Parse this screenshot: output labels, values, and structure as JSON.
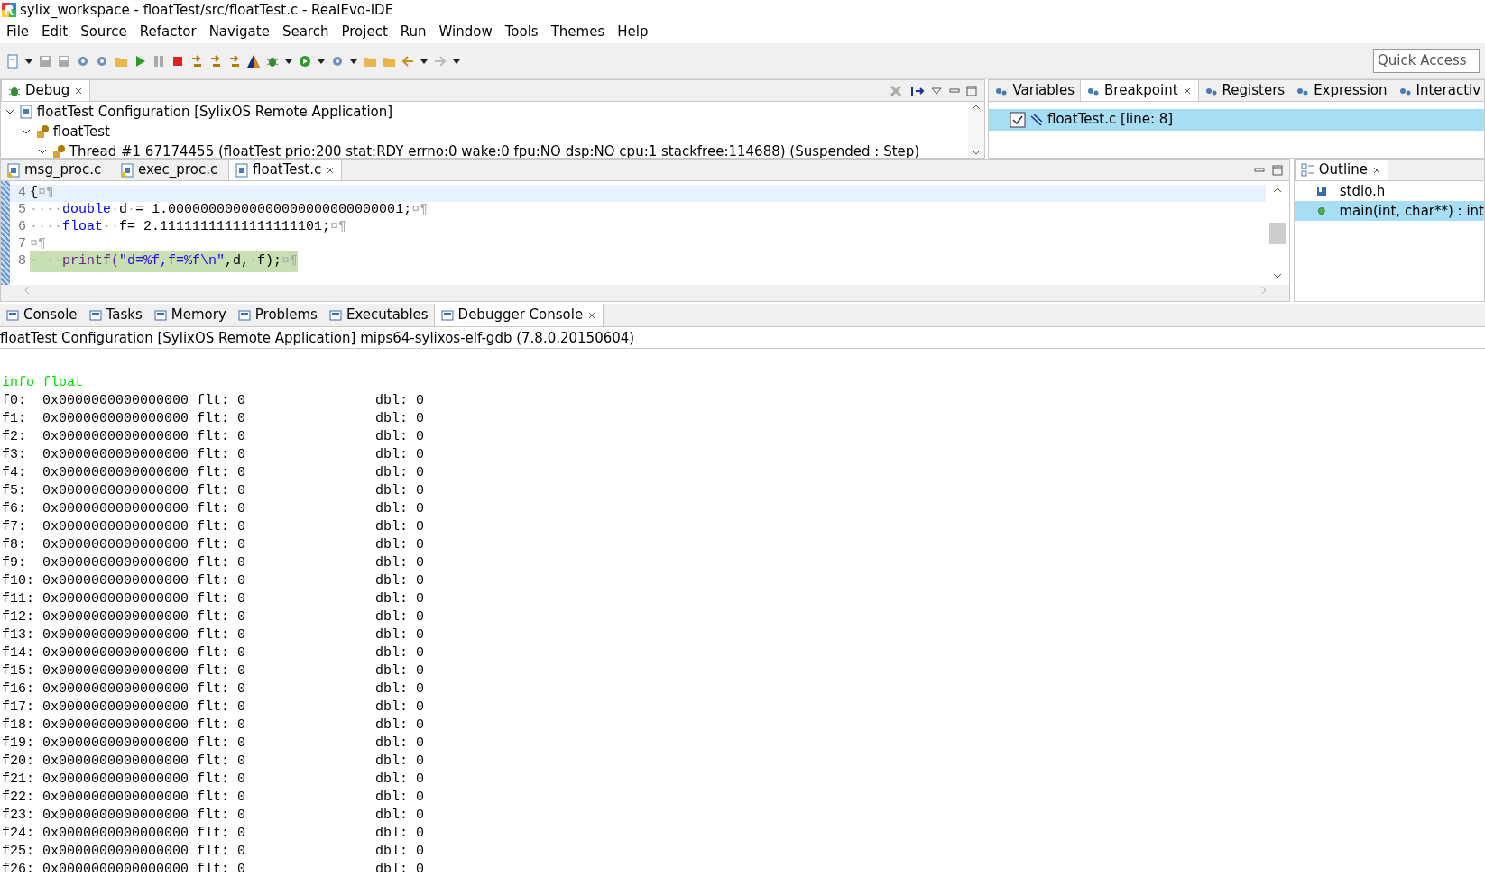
{
  "window": {
    "title": "sylix_workspace - floatTest/src/floatTest.c - RealEvo-IDE"
  },
  "menu": [
    "File",
    "Edit",
    "Source",
    "Refactor",
    "Navigate",
    "Search",
    "Project",
    "Run",
    "Window",
    "Tools",
    "Themes",
    "Help"
  ],
  "quick_access": {
    "placeholder": "Quick Access"
  },
  "debug_view": {
    "tab": "Debug",
    "tree": [
      {
        "label": "floatTest Configuration [SylixOS Remote Application]",
        "expanded": true,
        "children": [
          {
            "label": "floatTest",
            "expanded": true,
            "children": [
              {
                "label": "Thread #1 67174455 (floatTest prio:200 stat:RDY errno:0 wake:0 fpu:NO dsp:NO cpu:1 stackfree:114688) (Suspended : Step)",
                "expanded": true
              }
            ]
          }
        ]
      }
    ]
  },
  "right_tabs": [
    {
      "label": "Variables",
      "selected": false
    },
    {
      "label": "Breakpoint",
      "selected": true
    },
    {
      "label": "Registers",
      "selected": false
    },
    {
      "label": "Expression",
      "selected": false
    },
    {
      "label": "Interactiv",
      "selected": false
    }
  ],
  "breakpoints": [
    {
      "label": "floatTest.c [line: 8]",
      "checked": true,
      "selected": true
    }
  ],
  "editor_tabs": [
    {
      "label": "msg_proc.c",
      "selected": false
    },
    {
      "label": "exec_proc.c",
      "selected": false
    },
    {
      "label": "floatTest.c",
      "selected": true
    }
  ],
  "code_lines": [
    {
      "number": "4",
      "cursor_line": true,
      "execution_line": false,
      "tokens": [
        {
          "kind": "plain",
          "text": "{"
        },
        {
          "kind": "mark",
          "text": "¤¶"
        }
      ]
    },
    {
      "number": "5",
      "cursor_line": false,
      "execution_line": false,
      "tokens": [
        {
          "kind": "mark",
          "text": "····"
        },
        {
          "kind": "keyword",
          "text": "double"
        },
        {
          "kind": "mark",
          "text": "·"
        },
        {
          "kind": "plain",
          "text": "d"
        },
        {
          "kind": "mark",
          "text": "·"
        },
        {
          "kind": "plain",
          "text": "= 1.00000000000000000000000000001;"
        },
        {
          "kind": "mark",
          "text": "¤¶"
        }
      ]
    },
    {
      "number": "6",
      "cursor_line": false,
      "execution_line": false,
      "tokens": [
        {
          "kind": "mark",
          "text": "····"
        },
        {
          "kind": "keyword",
          "text": "float"
        },
        {
          "kind": "mark",
          "text": "··"
        },
        {
          "kind": "plain",
          "text": "f= 2.11111111111111111101;"
        },
        {
          "kind": "mark",
          "text": "¤¶"
        }
      ]
    },
    {
      "number": "7",
      "cursor_line": false,
      "execution_line": false,
      "tokens": [
        {
          "kind": "mark",
          "text": "¤¶"
        }
      ]
    },
    {
      "number": "8",
      "cursor_line": false,
      "execution_line": true,
      "tokens": [
        {
          "kind": "mark",
          "text": "····"
        },
        {
          "kind": "function",
          "text": "printf("
        },
        {
          "kind": "string",
          "text": "\"d=%f,f=%f\\n\""
        },
        {
          "kind": "plain",
          "text": ",d,"
        },
        {
          "kind": "mark",
          "text": "·"
        },
        {
          "kind": "plain",
          "text": "f);"
        },
        {
          "kind": "mark",
          "text": "¤¶"
        }
      ]
    }
  ],
  "outline": {
    "tab": "Outline",
    "items": [
      {
        "kind": "include",
        "label": "stdio.h",
        "selected": false
      },
      {
        "kind": "function",
        "label": "main(int, char**) : int",
        "selected": true
      }
    ]
  },
  "console_tabs": [
    {
      "label": "Console",
      "selected": false
    },
    {
      "label": "Tasks",
      "selected": false
    },
    {
      "label": "Memory",
      "selected": false
    },
    {
      "label": "Problems",
      "selected": false
    },
    {
      "label": "Executables",
      "selected": false
    },
    {
      "label": "Debugger Console",
      "selected": true
    }
  ],
  "console": {
    "header": "floatTest Configuration [SylixOS Remote Application] mips64-sylixos-elf-gdb (7.8.0.20150604)",
    "lines": [
      {
        "kind": "command",
        "text": "info float"
      },
      {
        "kind": "output",
        "text": "f0:  0x0000000000000000 flt: 0                dbl: 0"
      },
      {
        "kind": "output",
        "text": "f1:  0x0000000000000000 flt: 0                dbl: 0"
      },
      {
        "kind": "output",
        "text": "f2:  0x0000000000000000 flt: 0                dbl: 0"
      },
      {
        "kind": "output",
        "text": "f3:  0x0000000000000000 flt: 0                dbl: 0"
      },
      {
        "kind": "output",
        "text": "f4:  0x0000000000000000 flt: 0                dbl: 0"
      },
      {
        "kind": "output",
        "text": "f5:  0x0000000000000000 flt: 0                dbl: 0"
      },
      {
        "kind": "output",
        "text": "f6:  0x0000000000000000 flt: 0                dbl: 0"
      },
      {
        "kind": "output",
        "text": "f7:  0x0000000000000000 flt: 0                dbl: 0"
      },
      {
        "kind": "output",
        "text": "f8:  0x0000000000000000 flt: 0                dbl: 0"
      },
      {
        "kind": "output",
        "text": "f9:  0x0000000000000000 flt: 0                dbl: 0"
      },
      {
        "kind": "output",
        "text": "f10: 0x0000000000000000 flt: 0                dbl: 0"
      },
      {
        "kind": "output",
        "text": "f11: 0x0000000000000000 flt: 0                dbl: 0"
      },
      {
        "kind": "output",
        "text": "f12: 0x0000000000000000 flt: 0                dbl: 0"
      },
      {
        "kind": "output",
        "text": "f13: 0x0000000000000000 flt: 0                dbl: 0"
      },
      {
        "kind": "output",
        "text": "f14: 0x0000000000000000 flt: 0                dbl: 0"
      },
      {
        "kind": "output",
        "text": "f15: 0x0000000000000000 flt: 0                dbl: 0"
      },
      {
        "kind": "output",
        "text": "f16: 0x0000000000000000 flt: 0                dbl: 0"
      },
      {
        "kind": "output",
        "text": "f17: 0x0000000000000000 flt: 0                dbl: 0"
      },
      {
        "kind": "output",
        "text": "f18: 0x0000000000000000 flt: 0                dbl: 0"
      },
      {
        "kind": "output",
        "text": "f19: 0x0000000000000000 flt: 0                dbl: 0"
      },
      {
        "kind": "output",
        "text": "f20: 0x0000000000000000 flt: 0                dbl: 0"
      },
      {
        "kind": "output",
        "text": "f21: 0x0000000000000000 flt: 0                dbl: 0"
      },
      {
        "kind": "output",
        "text": "f22: 0x0000000000000000 flt: 0                dbl: 0"
      },
      {
        "kind": "output",
        "text": "f23: 0x0000000000000000 flt: 0                dbl: 0"
      },
      {
        "kind": "output",
        "text": "f24: 0x0000000000000000 flt: 0                dbl: 0"
      },
      {
        "kind": "output",
        "text": "f25: 0x0000000000000000 flt: 0                dbl: 0"
      },
      {
        "kind": "output",
        "text": "f26: 0x0000000000000000 flt: 0                dbl: 0"
      }
    ]
  }
}
